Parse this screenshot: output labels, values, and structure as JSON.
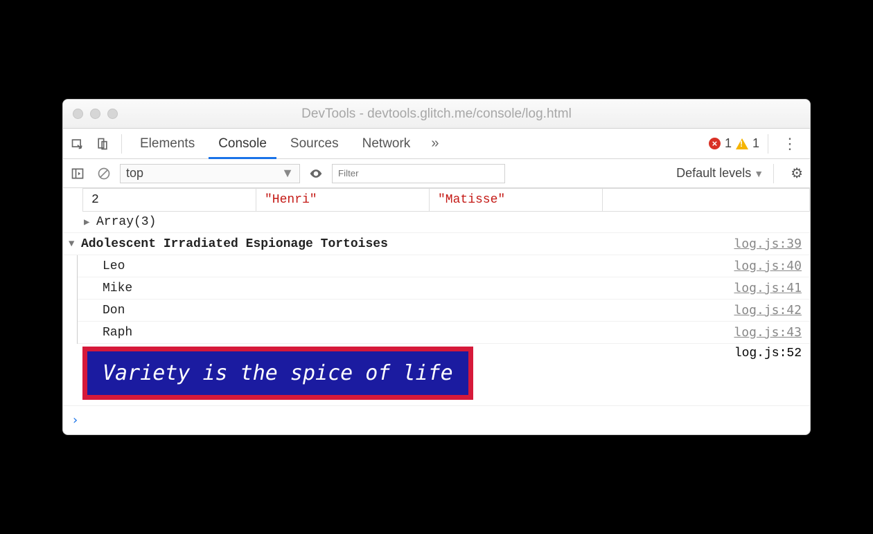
{
  "window": {
    "title": "DevTools - devtools.glitch.me/console/log.html"
  },
  "tabs": {
    "items": [
      "Elements",
      "Console",
      "Sources",
      "Network"
    ],
    "active_index": 1,
    "more_glyph": "»"
  },
  "status": {
    "error_count": "1",
    "warning_count": "1"
  },
  "toolbar": {
    "context": "top",
    "filter_placeholder": "Filter",
    "levels_label": "Default levels"
  },
  "table_row": {
    "index": "2",
    "cells": [
      "\"Henri\"",
      "\"Matisse\""
    ]
  },
  "array_preview": "Array(3)",
  "group": {
    "title": "Adolescent Irradiated Espionage Tortoises",
    "source": "log.js:39",
    "children": [
      {
        "text": "Leo",
        "source": "log.js:40"
      },
      {
        "text": "Mike",
        "source": "log.js:41"
      },
      {
        "text": "Don",
        "source": "log.js:42"
      },
      {
        "text": "Raph",
        "source": "log.js:43"
      }
    ]
  },
  "styled": {
    "text": "Variety is the spice of life",
    "source": "log.js:52"
  },
  "prompt": "›"
}
